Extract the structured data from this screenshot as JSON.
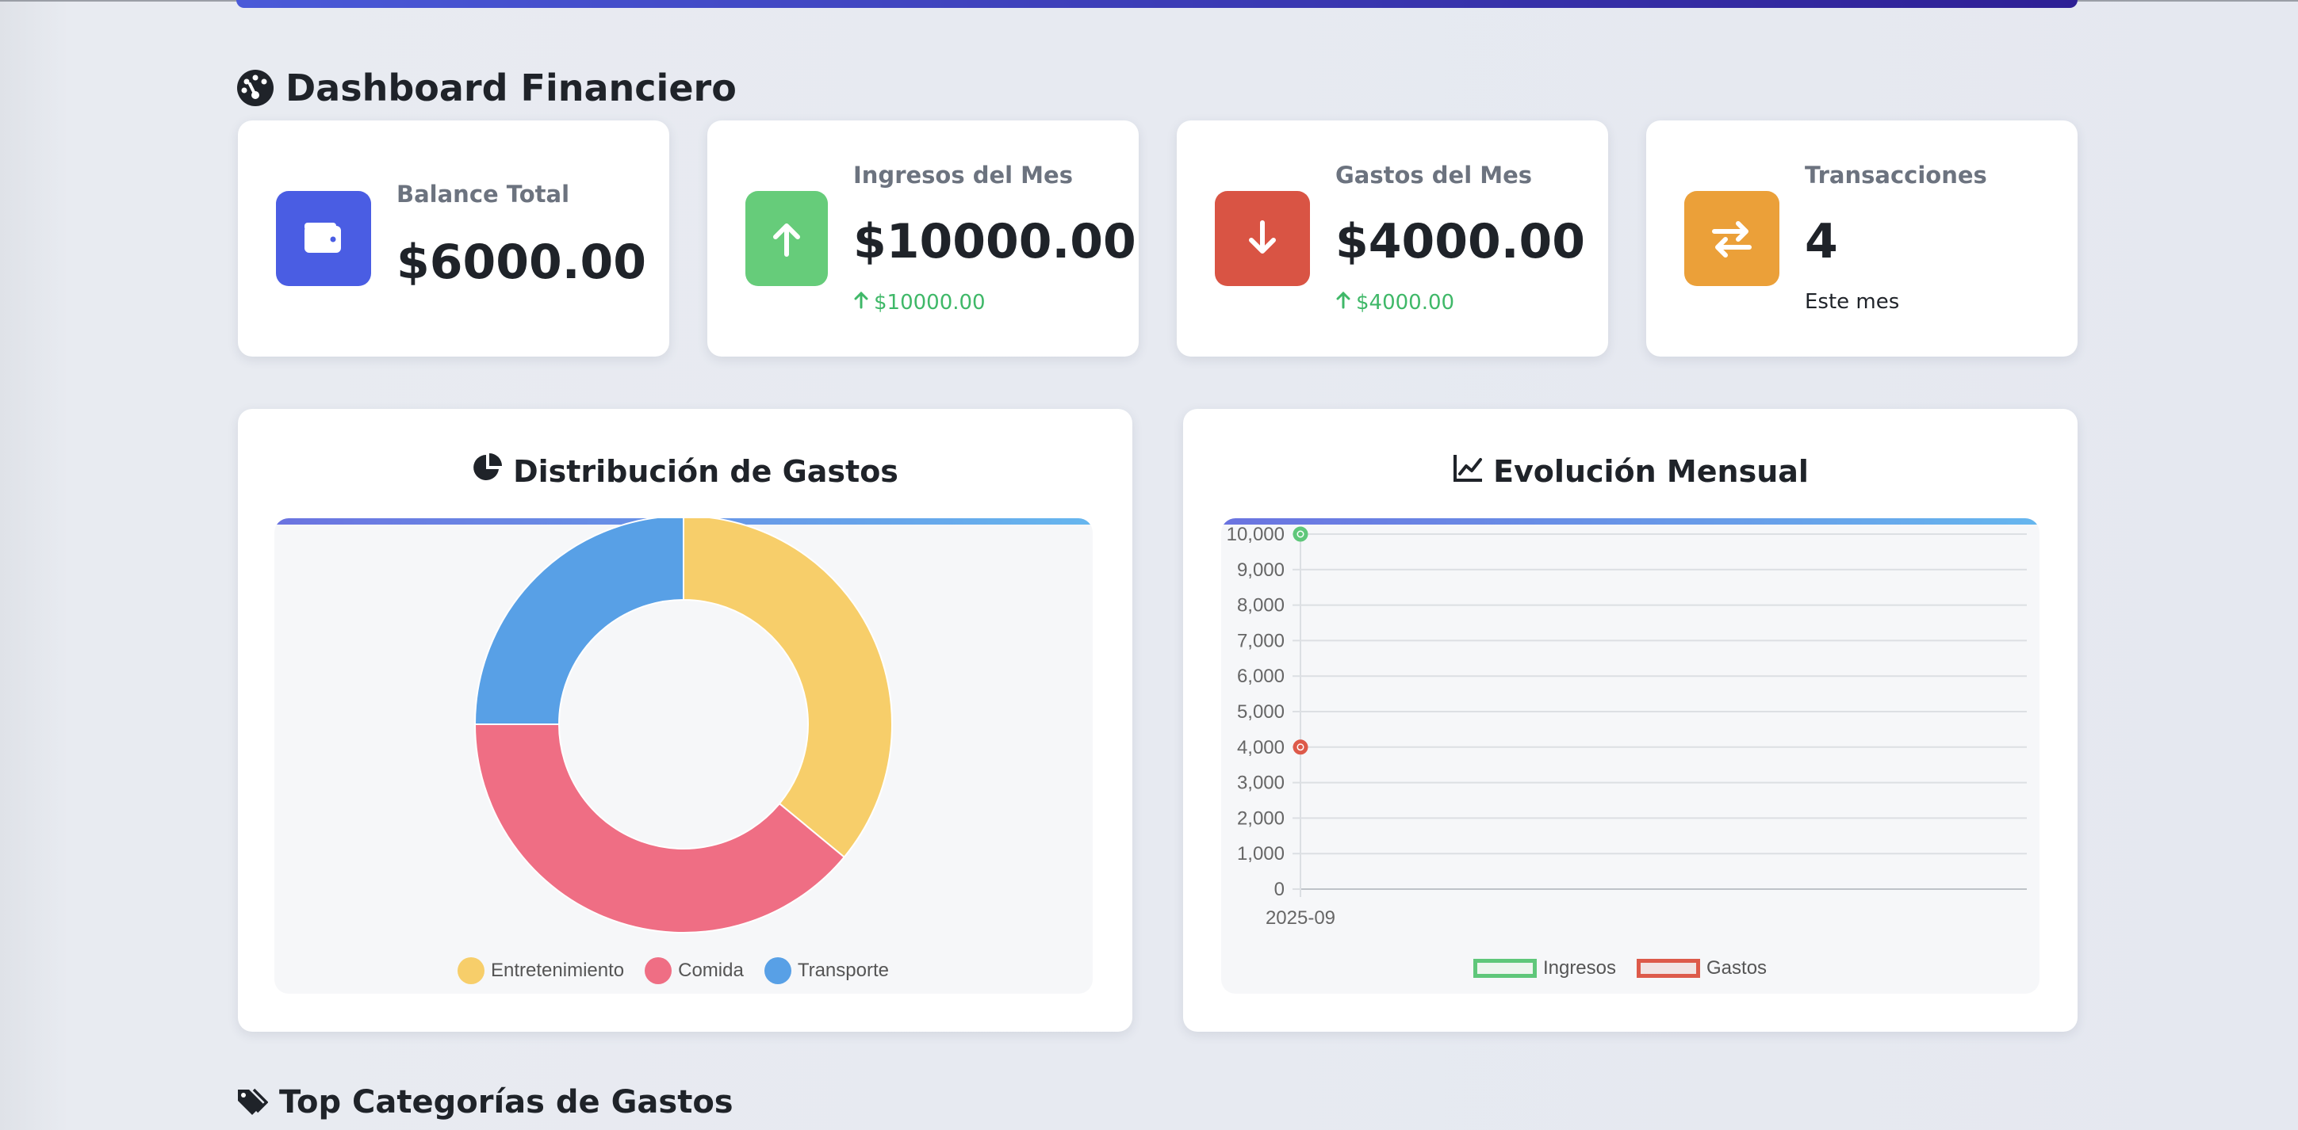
{
  "header": {
    "title": "Dashboard Financiero"
  },
  "stats": [
    {
      "label": "Balance Total",
      "value": "$6000.00",
      "icon": "wallet-icon",
      "color": "#4a5de3"
    },
    {
      "label": "Ingresos del Mes",
      "value": "$10000.00",
      "sub": "$10000.00",
      "icon": "arrow-up-icon",
      "color": "#66cc7a"
    },
    {
      "label": "Gastos del Mes",
      "value": "$4000.00",
      "sub": "$4000.00",
      "icon": "arrow-down-icon",
      "color": "#d95444"
    },
    {
      "label": "Transacciones",
      "value": "4",
      "note": "Este mes",
      "icon": "exchange-icon",
      "color": "#eba039"
    }
  ],
  "distribution": {
    "title": "Distribución de Gastos",
    "chart_data": {
      "type": "pie",
      "categories": [
        "Entretenimiento",
        "Comida",
        "Transporte"
      ],
      "values": [
        36,
        39,
        25
      ],
      "colors": [
        "#f7ce6a",
        "#ef6e84",
        "#58a0e6"
      ],
      "legend": "bottom"
    }
  },
  "evolution": {
    "title": "Evolución Mensual",
    "chart_data": {
      "type": "line",
      "x": [
        "2025-09"
      ],
      "series": [
        {
          "name": "Ingresos",
          "values": [
            10000
          ],
          "color": "#5fc77a"
        },
        {
          "name": "Gastos",
          "values": [
            4000
          ],
          "color": "#dd5a4a"
        }
      ],
      "ylim": [
        0,
        10000
      ],
      "yticks": [
        "10,000",
        "9,000",
        "8,000",
        "7,000",
        "6,000",
        "5,000",
        "4,000",
        "3,000",
        "2,000",
        "1,000",
        "0"
      ],
      "grid": true,
      "legend": "bottom"
    }
  },
  "top_categories": {
    "title": "Top Categorías de Gastos"
  }
}
